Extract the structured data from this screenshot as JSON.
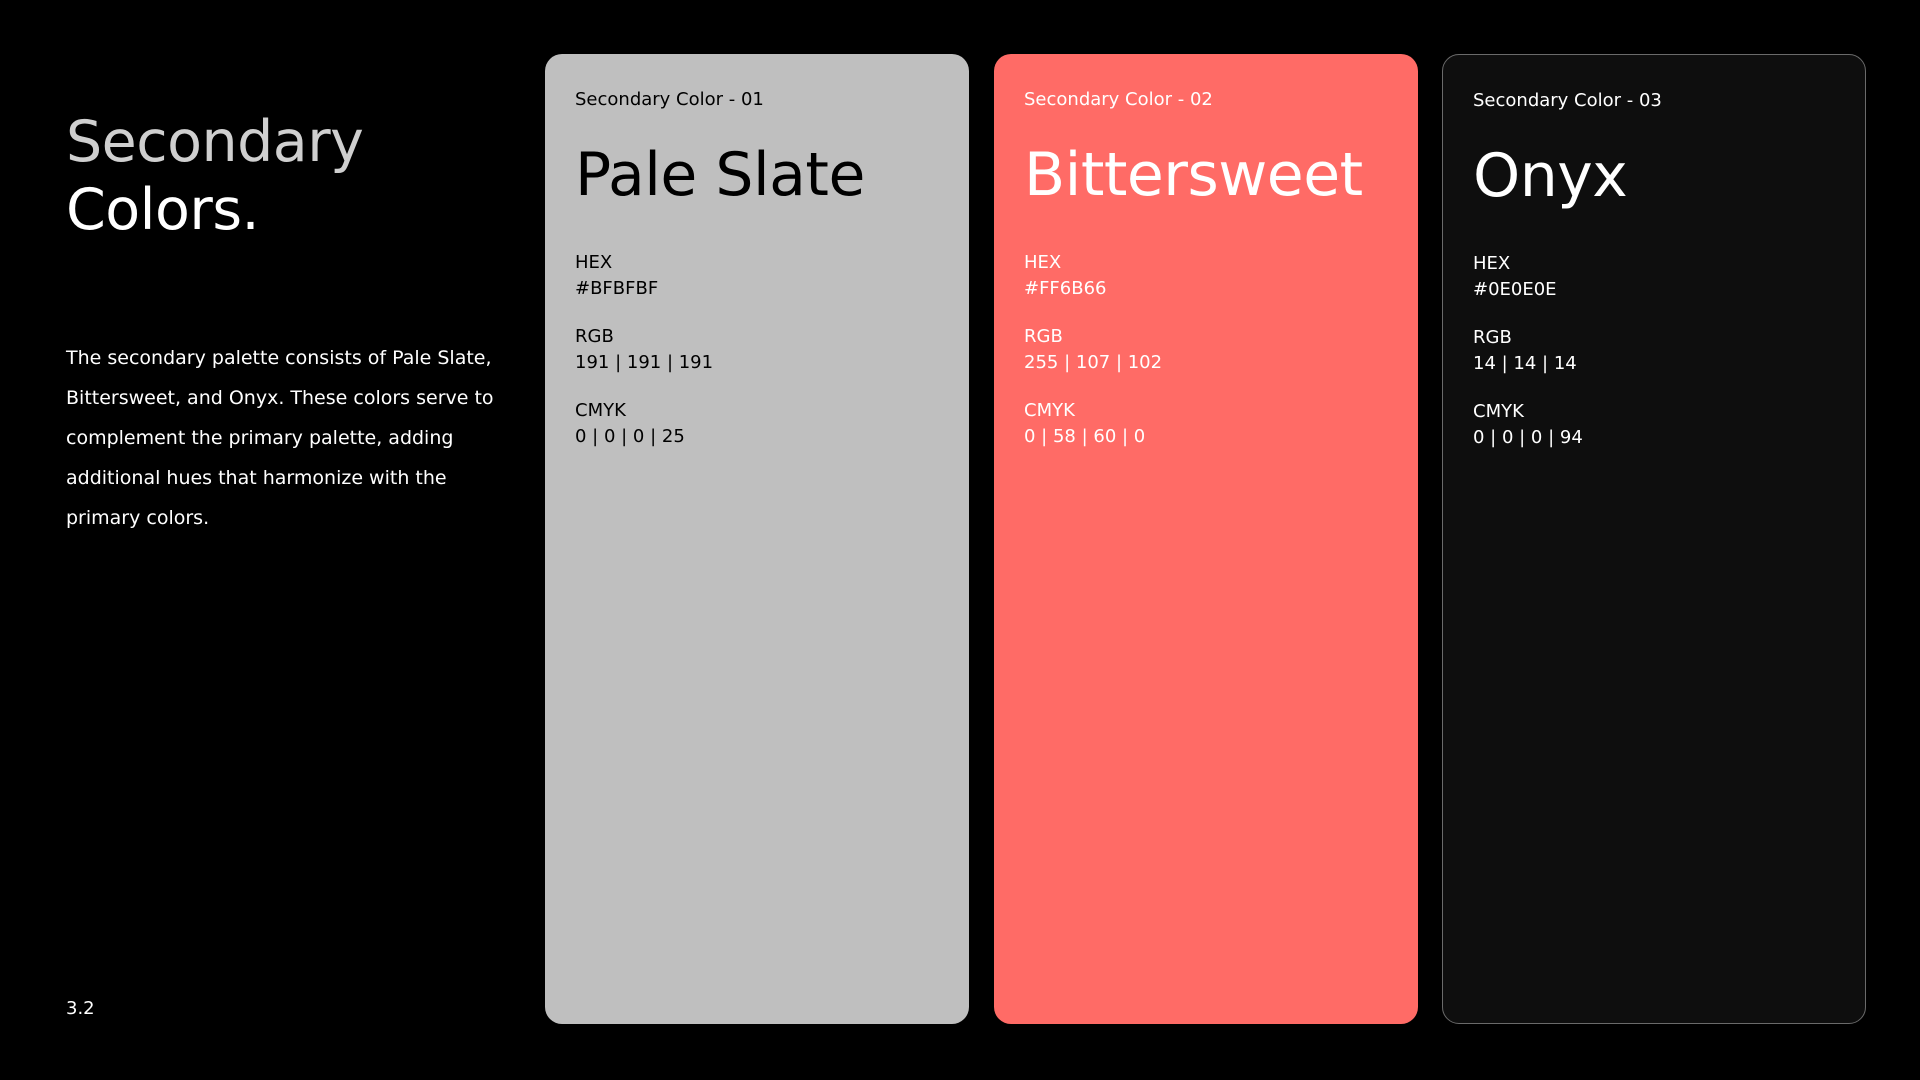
{
  "section": {
    "title_line1": "Secondary",
    "title_line2": "Colors.",
    "description": "The secondary palette consists of Pale Slate, Bittersweet, and Onyx. These colors serve to complement the primary palette, adding additional hues that harmonize with the primary colors.",
    "page_number": "3.2"
  },
  "colors": [
    {
      "label": "Secondary Color - 01",
      "name": "Pale Slate",
      "hex_label": "HEX",
      "hex": "#BFBFBF",
      "rgb_label": "RGB",
      "rgb": "191 | 191 | 191",
      "cmyk_label": "CMYK",
      "cmyk": "0 | 0 | 0 | 25",
      "swatch": "#bfbfbf",
      "text_color": "#000000"
    },
    {
      "label": "Secondary Color - 02",
      "name": "Bittersweet",
      "hex_label": "HEX",
      "hex": "#FF6B66",
      "rgb_label": "RGB",
      "rgb": "255 | 107 | 102",
      "cmyk_label": "CMYK",
      "cmyk": "0 | 58 | 60 | 0",
      "swatch": "#ff6b66",
      "text_color": "#ffffff"
    },
    {
      "label": "Secondary Color - 03",
      "name": "Onyx",
      "hex_label": "HEX",
      "hex": "#0E0E0E",
      "rgb_label": "RGB",
      "rgb": "14 | 14 | 14",
      "cmyk_label": "CMYK",
      "cmyk": "0 | 0 | 0 | 94",
      "swatch": "#0e0e0e",
      "text_color": "#ffffff"
    }
  ]
}
